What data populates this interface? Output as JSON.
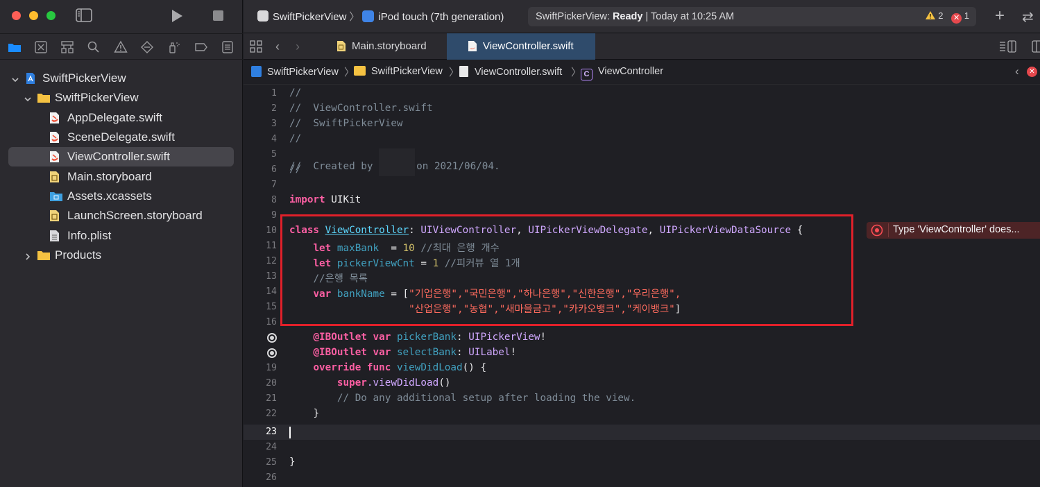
{
  "sidebar": {
    "tree": [
      {
        "label": "SwiftPickerView",
        "icon": "project-icon",
        "expanded": true
      },
      {
        "label": "SwiftPickerView",
        "icon": "folder-icon",
        "expanded": true
      },
      {
        "label": "AppDelegate.swift",
        "icon": "swift-file-icon"
      },
      {
        "label": "SceneDelegate.swift",
        "icon": "swift-file-icon"
      },
      {
        "label": "ViewController.swift",
        "icon": "swift-file-icon",
        "selected": true
      },
      {
        "label": "Main.storyboard",
        "icon": "storyboard-icon"
      },
      {
        "label": "Assets.xcassets",
        "icon": "assets-folder-icon"
      },
      {
        "label": "LaunchScreen.storyboard",
        "icon": "storyboard-icon"
      },
      {
        "label": "Info.plist",
        "icon": "plist-icon"
      },
      {
        "label": "Products",
        "icon": "folder-icon",
        "expanded": false
      }
    ]
  },
  "toolbar": {
    "scheme": "SwiftPickerView",
    "destination": "iPod touch (7th generation)",
    "status_prefix": "SwiftPickerView:",
    "status_state": "Ready",
    "status_time": "Today at 10:25 AM",
    "warning_count": "2",
    "error_count": "1"
  },
  "tabs": [
    {
      "label": "Main.storyboard",
      "icon": "storyboard-icon"
    },
    {
      "label": "ViewController.swift",
      "icon": "swift-file-icon",
      "active": true
    }
  ],
  "jump_bar": [
    "SwiftPickerView",
    "SwiftPickerView",
    "ViewController.swift",
    "ViewController"
  ],
  "editor": {
    "current_line": "23",
    "error_message": "Type 'ViewController' does...",
    "colors": {
      "keyword": "#fc5fa3",
      "string": "#fc6a5d",
      "number": "#d0bf69",
      "comment": "#7f8c98",
      "type": "#d0a8ff",
      "highlight": "#e0202a"
    }
  },
  "code": {
    "l1": "//",
    "l2": "//  ViewController.swift",
    "l3": "//  SwiftPickerView",
    "l4": "//",
    "l5_a": "//  Created by ",
    "l5_b": "on 2021/06/04.",
    "l6": "//",
    "l8_kw": "import",
    "l8_mod": " UIKit",
    "l10_kw": "class",
    "l10_name": "ViewController",
    "l10_colon": ": ",
    "l10_t1": "UIViewController",
    "l10_comma1": ", ",
    "l10_t2": "UIPickerViewDelegate",
    "l10_comma2": ", ",
    "l10_t3": "UIPickerViewDataSource",
    "l10_brace": " {",
    "l11_kw": "let",
    "l11_name": " maxBank",
    "l11_eq": "  = ",
    "l11_num": "10",
    "l11_c": " //최대 은행 개수",
    "l12_kw": "let",
    "l12_name": " pickerViewCnt",
    "l12_eq": " = ",
    "l12_num": "1",
    "l12_c": " //피커뷰 열 1개",
    "l13": "//은행 목록",
    "l14_kw": "var",
    "l14_name": " bankName",
    "l14_eq": " = [",
    "l14_s": "\"기업은행\",\"국민은행\",\"하나은행\",\"신한은행\",\"우리은행\",",
    "l15_s": "\"산업은행\",\"농협\",\"새마을금고\",\"카카오뱅크\",\"케이뱅크\"",
    "l15_end": "]",
    "l17_attr": "@IBOutlet",
    "l17_kw": " var",
    "l17_name": " pickerBank",
    "l17_colon": ": ",
    "l17_type": "UIPickerView",
    "l17_bang": "!",
    "l18_attr": "@IBOutlet",
    "l18_kw": " var",
    "l18_name": " selectBank",
    "l18_colon": ": ",
    "l18_type": "UILabel",
    "l18_bang": "!",
    "l19_kw": "override func",
    "l19_name": " viewDidLoad",
    "l19_rest": "() {",
    "l20_kw": "super",
    "l20_rest": ".viewDidLoad",
    "l20_end": "()",
    "l21": "// Do any additional setup after loading the view.",
    "l22": "}",
    "l25": "}"
  }
}
